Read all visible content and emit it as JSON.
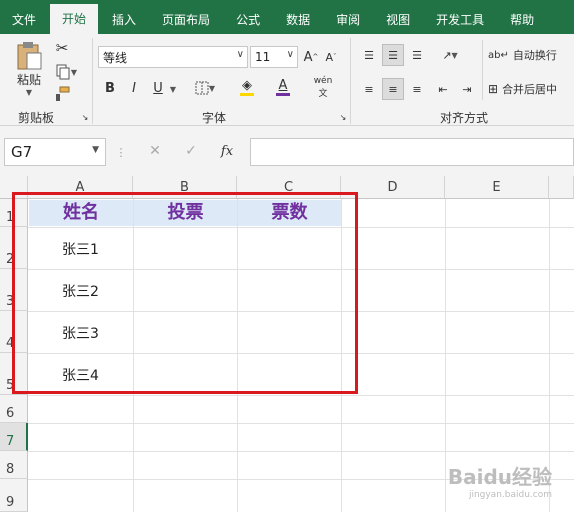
{
  "tabs": [
    "文件",
    "开始",
    "插入",
    "页面布局",
    "公式",
    "数据",
    "审阅",
    "视图",
    "开发工具",
    "帮助"
  ],
  "active_tab": "开始",
  "ribbon": {
    "paste_label": "粘贴",
    "clipboard_label": "剪贴板",
    "font_name": "等线",
    "font_size": "11",
    "bold": "B",
    "italic": "I",
    "underline": "U",
    "font_group_label": "字体",
    "phonetic": "wén",
    "wrap_text": "自动换行",
    "merge_center": "合并后居中",
    "align_group_label": "对齐方式",
    "font_color": "#7030a0"
  },
  "formula_bar": {
    "name_box": "G7",
    "fx": "fx",
    "value": ""
  },
  "sheet": {
    "columns": [
      "A",
      "B",
      "C",
      "D",
      "E"
    ],
    "rows": [
      "1",
      "2",
      "3",
      "4",
      "5",
      "6",
      "7",
      "8",
      "9"
    ],
    "selected_row": "7",
    "header_row": [
      "姓名",
      "投票",
      "票数"
    ],
    "names": [
      "张三1",
      "张三2",
      "张三3",
      "张三4"
    ]
  },
  "watermark": {
    "brand": "Baidu经验",
    "url": "jingyan.baidu.com"
  }
}
